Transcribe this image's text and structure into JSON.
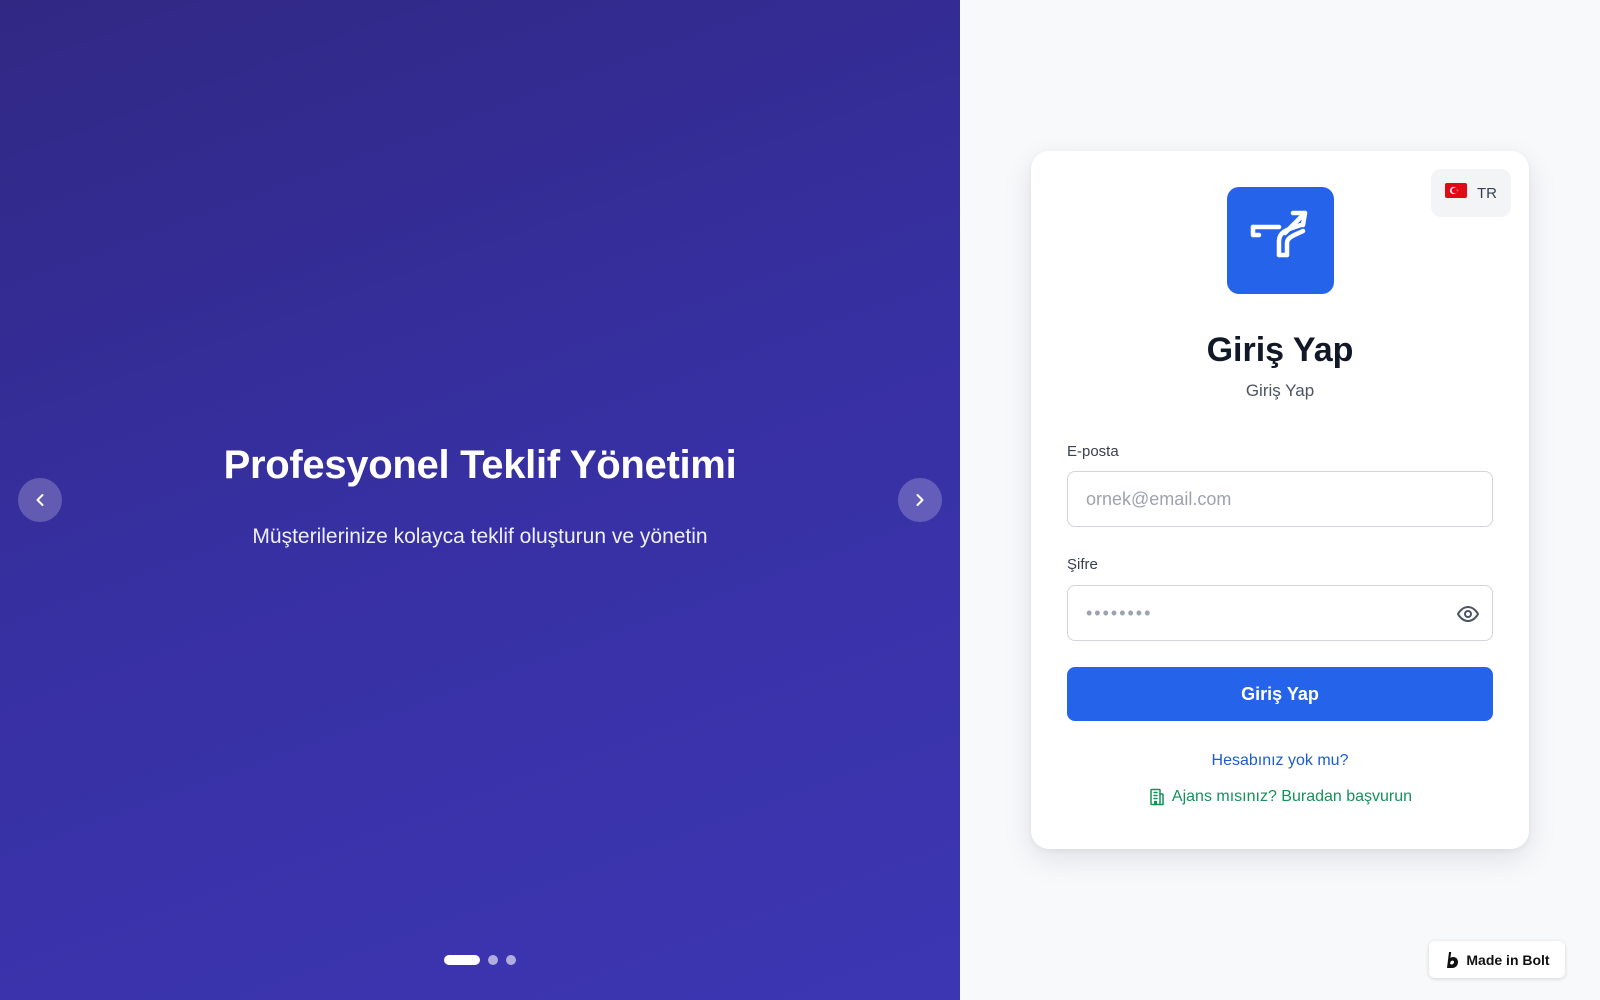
{
  "hero": {
    "title": "Profesyonel Teklif Yönetimi",
    "subtitle": "Müşterilerinize kolayca teklif oluşturun ve yönetin",
    "prev_icon": "chevron-left-icon",
    "next_icon": "chevron-right-icon",
    "slide_count": 3,
    "active_slide": 1
  },
  "language": {
    "flag": "🇹🇷",
    "code": "TR",
    "flag_icon": "turkey-flag-icon"
  },
  "login": {
    "logo_icon": "arrow-up-right-logo-icon",
    "title": "Giriş Yap",
    "subtitle": "Giriş Yap",
    "email_label": "E-posta",
    "email_placeholder": "ornek@email.com",
    "email_value": "",
    "password_label": "Şifre",
    "password_placeholder": "••••••••",
    "password_value": "",
    "show_password_icon": "eye-icon",
    "submit_label": "Giriş Yap",
    "signup_link": "Hesabınız yok mu?",
    "agency_link": "Ajans mısınız? Buradan başvurun",
    "agency_icon": "building-icon"
  },
  "badge": {
    "label": "Made in Bolt",
    "icon": "bolt-logo-icon"
  },
  "colors": {
    "hero_start": "#312884",
    "hero_end": "#3d36b3",
    "primary": "#2563eb",
    "agency_link": "#15915a",
    "background": "#f8f9fb"
  }
}
